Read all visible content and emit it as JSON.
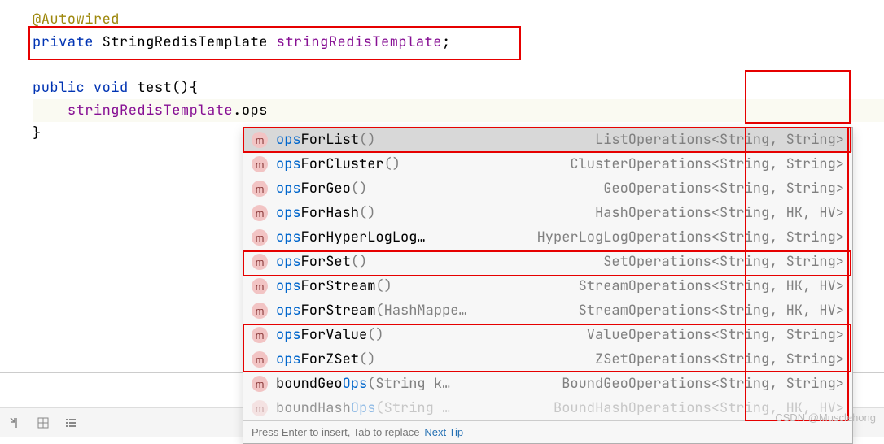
{
  "code": {
    "line1_annotation": "@Autowired",
    "line2_private": "private",
    "line2_type": "StringRedisTemplate",
    "line2_field": "stringRedisTemplate",
    "line2_semi": ";",
    "line4_public": "public",
    "line4_void": "void",
    "line4_method": "test",
    "line4_parens": "(){",
    "line5_field": "stringRedisTemplate",
    "line5_dot": ".",
    "line5_partial": "ops",
    "line6_brace": "}"
  },
  "completions": [
    {
      "prefix": "ops",
      "rest": "ForList",
      "params": "()",
      "return": "ListOperations<String, String>",
      "selected": true
    },
    {
      "prefix": "ops",
      "rest": "ForCluster",
      "params": "()",
      "return": "ClusterOperations<String, String>",
      "selected": false
    },
    {
      "prefix": "ops",
      "rest": "ForGeo",
      "params": "()",
      "return": "GeoOperations<String, String>",
      "selected": false
    },
    {
      "prefix": "ops",
      "rest": "ForHash",
      "params": "()",
      "return": "HashOperations<String, HK, HV>",
      "selected": false
    },
    {
      "prefix": "ops",
      "rest": "ForHyperLogLog…",
      "params": "",
      "return": "HyperLogLogOperations<String, String>",
      "selected": false
    },
    {
      "prefix": "ops",
      "rest": "ForSet",
      "params": "()",
      "return": "SetOperations<String, String>",
      "selected": false
    },
    {
      "prefix": "ops",
      "rest": "ForStream",
      "params": "()",
      "return": "StreamOperations<String, HK, HV>",
      "selected": false
    },
    {
      "prefix": "ops",
      "rest": "ForStream",
      "params": "(HashMappe…",
      "return": "StreamOperations<String, HK, HV>",
      "selected": false
    },
    {
      "prefix": "ops",
      "rest": "ForValue",
      "params": "()",
      "return": "ValueOperations<String, String>",
      "selected": false
    },
    {
      "prefix": "ops",
      "rest": "ForZSet",
      "params": "()",
      "return": "ZSetOperations<String, String>",
      "selected": false
    },
    {
      "prefix": "",
      "rest": "boundGeo",
      "bluesuffix": "Ops",
      "params": "(String k…",
      "return": "BoundGeoOperations<String, String>",
      "selected": false
    },
    {
      "prefix": "",
      "rest": "boundHash",
      "bluesuffix": "Ops",
      "params": "(String …",
      "return": "BoundHashOperations<String, HK, HV>",
      "selected": false,
      "faded": true
    }
  ],
  "footer": {
    "text": "Press Enter to insert, Tab to replace",
    "link": "Next Tip"
  },
  "watermark": "CSDN @Musclehong",
  "icons": {
    "method_letter": "m"
  }
}
